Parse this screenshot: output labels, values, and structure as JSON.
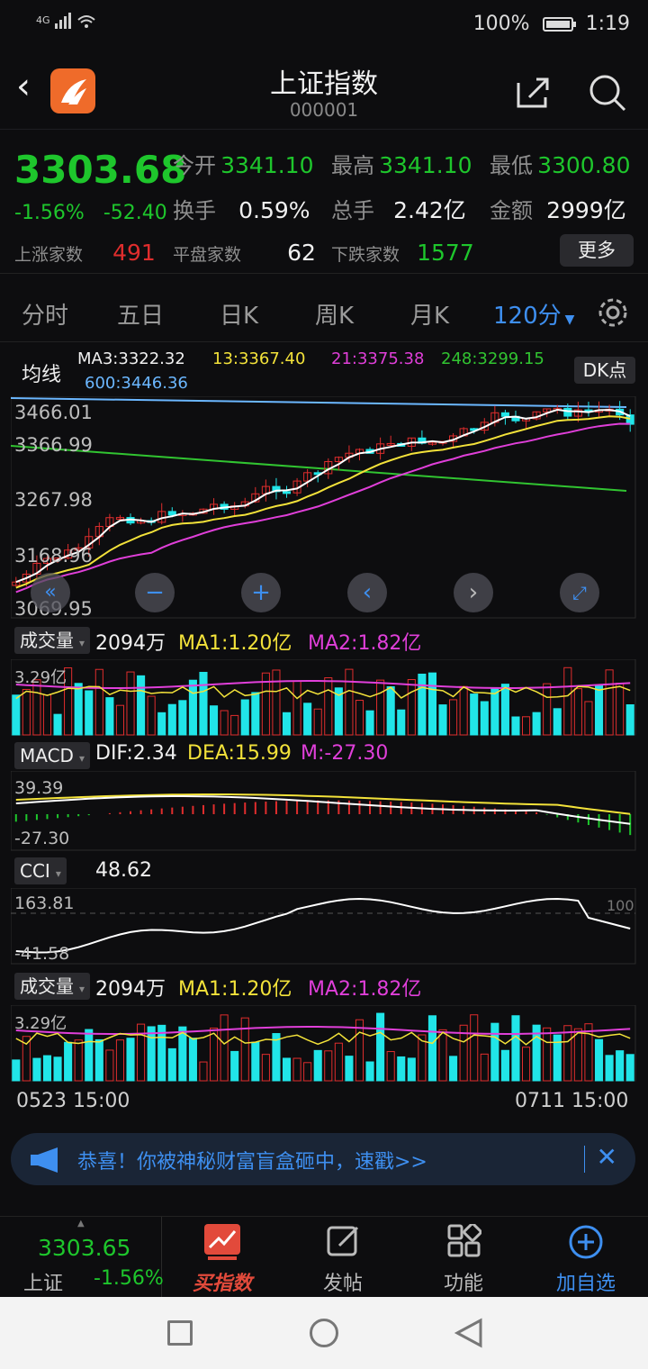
{
  "status_bar": {
    "network": "4G",
    "battery": "100%",
    "time": "1:19"
  },
  "header": {
    "title": "上证指数",
    "code": "000001"
  },
  "quote": {
    "price": "3303.68",
    "change_pct": "-1.56%",
    "change": "-52.40",
    "rows": [
      [
        {
          "label": "今开",
          "value": "3341.10"
        },
        {
          "label": "最高",
          "value": "3341.10"
        },
        {
          "label": "最低",
          "value": "3300.80"
        }
      ],
      [
        {
          "label": "换手",
          "value": "0.59%"
        },
        {
          "label": "总手",
          "value": "2.42亿"
        },
        {
          "label": "金额",
          "value": "2999亿"
        }
      ]
    ],
    "breadth": [
      {
        "label": "上涨家数",
        "value": "491"
      },
      {
        "label": "平盘家数",
        "value": "62"
      },
      {
        "label": "下跌家数",
        "value": "1577"
      }
    ],
    "more_label": "更多"
  },
  "tabs": [
    "分时",
    "五日",
    "日K",
    "周K",
    "月K",
    "120分"
  ],
  "main_chart": {
    "indicator": "均线",
    "ma3": "MA3:3322.32",
    "ma13": "13:3367.40",
    "ma21": "21:3375.38",
    "ma248": "248:3299.15",
    "ma600": "600:3446.36",
    "dk_label": "DK点",
    "y_labels": [
      "3466.01",
      "3366.99",
      "3267.98",
      "3168.96",
      "3069.95"
    ]
  },
  "volume1": {
    "selector": "成交量",
    "value": "2094万",
    "ma1": "MA1:1.20亿",
    "ma2": "MA2:1.82亿",
    "y_label": "3.29亿"
  },
  "macd": {
    "selector": "MACD",
    "dif": "DIF:2.34",
    "dea": "DEA:15.99",
    "m": "M:-27.30",
    "y_top": "39.39",
    "y_bottom": "-27.30"
  },
  "cci": {
    "selector": "CCI",
    "value": "48.62",
    "y_top": "163.81",
    "y_bottom": "-41.58",
    "ref": "100"
  },
  "volume2": {
    "selector": "成交量",
    "value": "2094万",
    "ma1": "MA1:1.20亿",
    "ma2": "MA2:1.82亿",
    "y_label": "3.29亿"
  },
  "time_axis": {
    "start": "0523 15:00",
    "end": "0711 15:00"
  },
  "banner": {
    "text": "恭喜！你被神秘财富盲盒砸中，速戳>>"
  },
  "bottom_bar": {
    "ticker_price": "3303.65",
    "ticker_name": "上证",
    "ticker_change": "-1.56%",
    "items": [
      "买指数",
      "发帖",
      "功能",
      "加自选"
    ]
  },
  "colors": {
    "up": "#e02d2d",
    "down": "#1ec62c",
    "accent": "#3e8ff0",
    "cyan": "#21e5e8"
  }
}
